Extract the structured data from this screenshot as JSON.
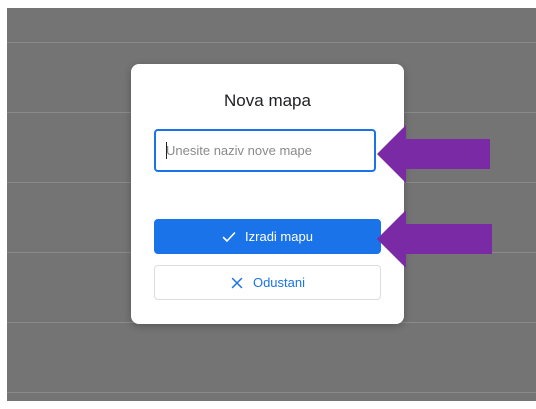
{
  "dialog": {
    "title": "Nova mapa",
    "input_placeholder": "Unesite naziv nove mape",
    "input_value": "",
    "create_button_label": "Izradi mapu",
    "cancel_button_label": "Odustani"
  },
  "icons": {
    "create": "check-icon",
    "cancel": "close-icon"
  },
  "annotations": {
    "arrow_color": "#7b2aa6",
    "arrows": [
      "arrow-pointing-to-input",
      "arrow-pointing-to-create-button"
    ]
  },
  "colors": {
    "accent": "#1a73e8",
    "backdrop": "#747474"
  }
}
